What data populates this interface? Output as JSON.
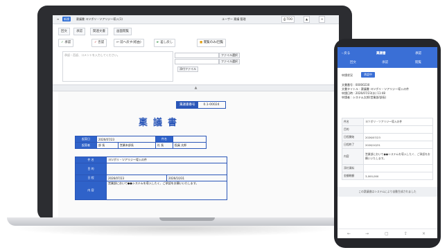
{
  "laptop": {
    "title_bar": {
      "new_chip": "新規",
      "doc_title": "稟議書 ヨツボリ・ツアリジー導入(1)",
      "user": "ユーザー 稟議 管理",
      "icon_chip": "TOO"
    },
    "tabs": [
      "回文",
      "承認",
      "関連文書",
      "画面閲覧"
    ],
    "toolbar": {
      "approve": "承認",
      "reject": "否認",
      "return_to_prev": "前へ戻す(経由)",
      "return_to_start": "差し戻し",
      "view_only": "閲覧のみ/回覧"
    },
    "comment_placeholder": "承認・否認、コメントを入力してください。",
    "file_buttons": [
      "ファイル選択",
      "ファイル選択"
    ],
    "submit_button": "添付ファイル",
    "document": {
      "number_label": "稟議書番号",
      "number_value": "0.1-00024",
      "title": "稟議書",
      "header_table": [
        {
          "label": "起案日",
          "value": "2026/07/23",
          "label2": "件名",
          "value2": ""
        },
        {
          "label": "起案者",
          "value": "部 長",
          "value_b": "営業本部長",
          "label2": "社 長",
          "value2": "役員 太郎"
        }
      ],
      "body_table": [
        {
          "label": "件 名",
          "value": "ヨツボリ・ツアリジー導入の件"
        },
        {
          "label": "目 的",
          "value": ""
        },
        {
          "label": "日 程",
          "value": "2026/07/23",
          "value2": "2026/10/31"
        },
        {
          "label": "内 容",
          "value": "営業部において●●システムを導入したく、ご承認をお願いいたします。"
        }
      ]
    }
  },
  "phone": {
    "header": {
      "back": "戻る",
      "title": "稟議書",
      "action": "承認"
    },
    "tabs": [
      "回文",
      "承認",
      "閲覧"
    ],
    "status_label": "申請状況",
    "status_badge": "承認中",
    "info_lines": [
      "文書番号 : 00000230",
      "文書タイトル : 稟議書 ヨツボリ・ツアリジー導入の件",
      "申請日時 : 2026/07/23(水) 11:48",
      "申請者 : システム太郎(営業部/部長)"
    ],
    "rows": [
      {
        "k": "件名",
        "v": "ヨツボリ・ツアリジー導入の件"
      },
      {
        "k": "目的",
        "v": ""
      },
      {
        "k": "日程開始",
        "v": "2026/07/23"
      },
      {
        "k": "日程終了",
        "v": "2026/10/31"
      },
      {
        "k": "内容",
        "v": "営業部において●●システムを導入したく、ご承認をお願いいたします。"
      },
      {
        "k": "添付資料",
        "v": ""
      },
      {
        "k": "金額総額",
        "v": "3,000,000"
      }
    ],
    "bottom_bar": "この稟議書はシステムにより自動生成されました"
  }
}
